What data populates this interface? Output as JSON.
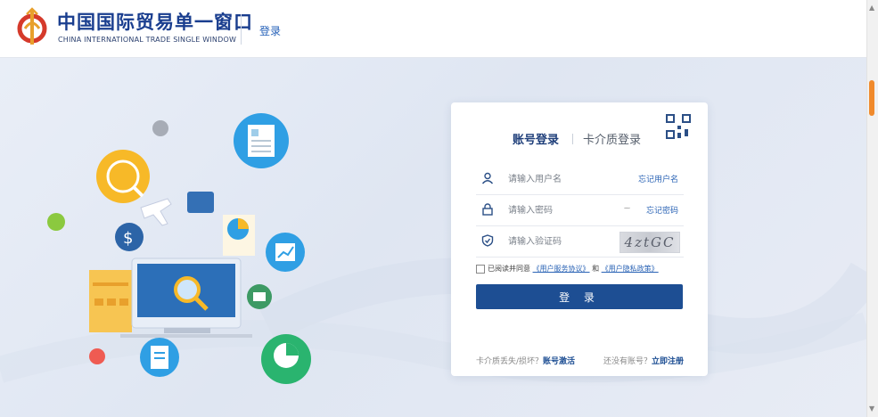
{
  "header": {
    "brand_cn": "中国国际贸易单一窗口",
    "brand_en": "CHINA INTERNATIONAL TRADE SINGLE WINDOW",
    "login_link": "登录"
  },
  "login_card": {
    "tabs": [
      {
        "label": "账号登录",
        "active": true
      },
      {
        "label": "卡介质登录",
        "active": false
      }
    ],
    "username": {
      "placeholder": "请输入用户名",
      "forgot": "忘记用户名",
      "icon": "user-icon"
    },
    "password": {
      "placeholder": "请输入密码",
      "forgot": "忘记密码",
      "icon": "lock-icon"
    },
    "captcha": {
      "placeholder": "请输入验证码",
      "image_text": "4ztGC",
      "icon": "shield-icon"
    },
    "agreement": {
      "prefix": "已阅读并同意",
      "service_link": "《用户服务协议》",
      "and": "和",
      "privacy_link": "《用户隐私政策》"
    },
    "login_button": "登 录",
    "footer": {
      "lost_text": "卡介质丢失/损坏？",
      "lost_link": "账号激活",
      "no_account_text": "还没有账号？",
      "register_link": "立即注册"
    }
  },
  "colors": {
    "primary": "#1d4e93",
    "link": "#2a63b5",
    "scroll_thumb": "#f08a2c",
    "background": "#e4e9f3"
  }
}
